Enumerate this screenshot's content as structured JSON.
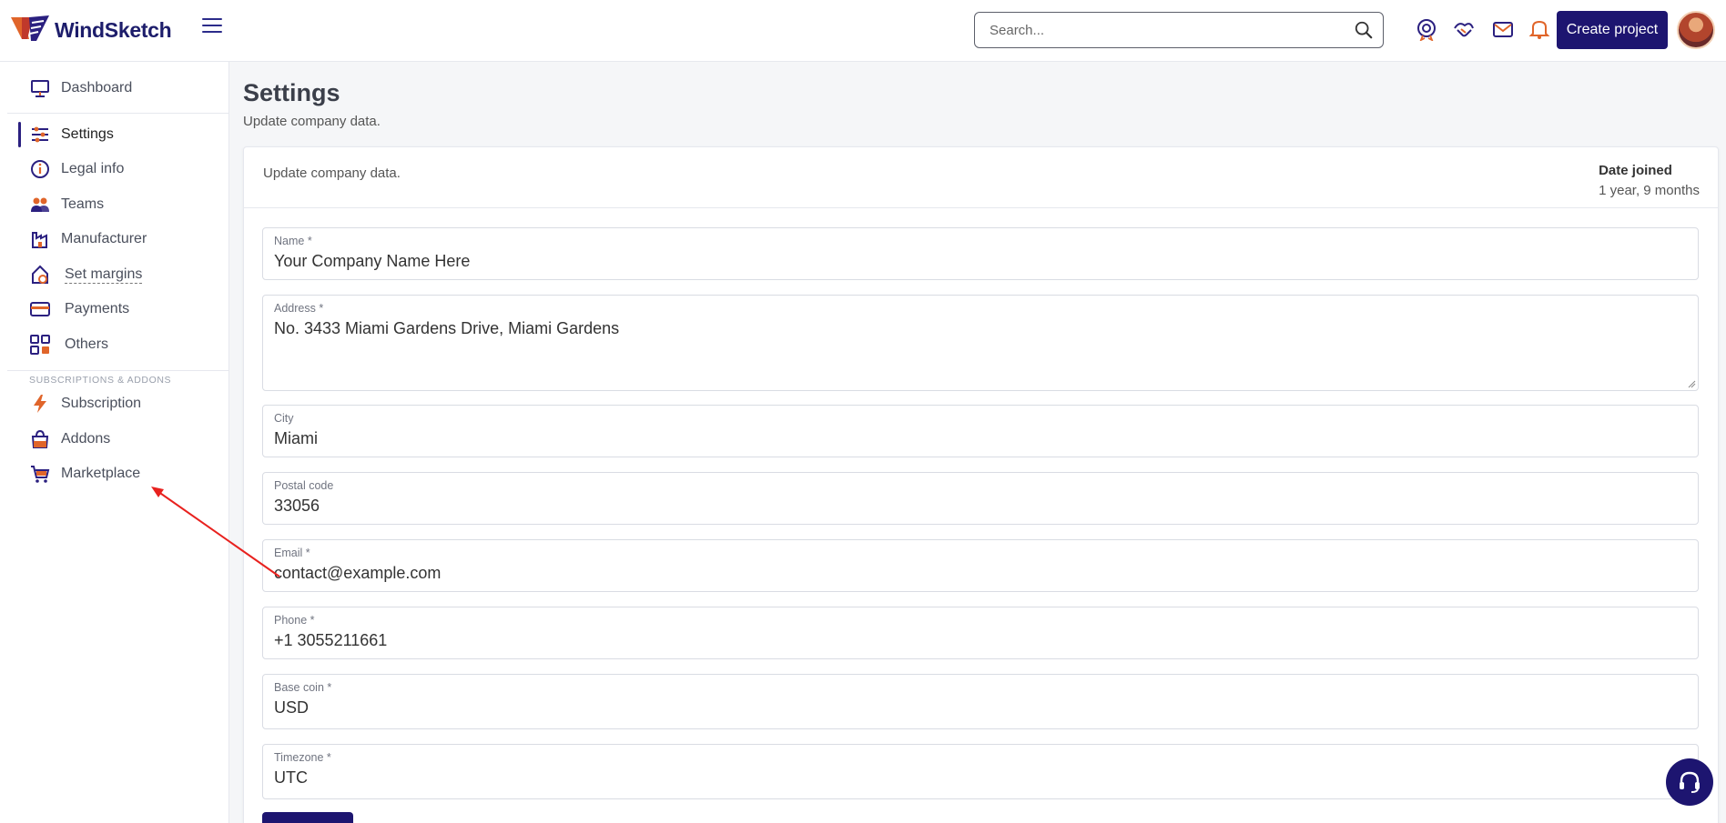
{
  "brand": {
    "name": "WindSketch"
  },
  "search": {
    "placeholder": "Search..."
  },
  "header": {
    "create_label": "Create project"
  },
  "sidebar": {
    "items": [
      {
        "label": "Dashboard",
        "icon": "monitor-icon"
      },
      {
        "label": "Settings",
        "icon": "sliders-icon",
        "active": true
      },
      {
        "label": "Legal info",
        "icon": "info-icon"
      },
      {
        "label": "Teams",
        "icon": "team-icon"
      },
      {
        "label": "Manufacturer",
        "icon": "factory-icon"
      },
      {
        "label": "Set margins",
        "icon": "margin-tag-icon"
      },
      {
        "label": "Payments",
        "icon": "card-icon"
      },
      {
        "label": "Others",
        "icon": "grid-icon"
      }
    ],
    "section_title": "SUBSCRIPTIONS & ADDONS",
    "addon_items": [
      {
        "label": "Subscription",
        "icon": "bolt-icon"
      },
      {
        "label": "Addons",
        "icon": "addon-bag-icon"
      },
      {
        "label": "Marketplace",
        "icon": "cart-icon"
      }
    ]
  },
  "page": {
    "title": "Settings",
    "subtitle": "Update company data."
  },
  "card": {
    "description": "Update company data.",
    "date_joined_label": "Date joined",
    "date_joined_value": "1 year, 9 months"
  },
  "form": {
    "name": {
      "label": "Name *",
      "value": "Your Company Name Here"
    },
    "address": {
      "label": "Address *",
      "value": "No. 3433 Miami Gardens Drive, Miami Gardens"
    },
    "city": {
      "label": "City",
      "value": "Miami"
    },
    "postal": {
      "label": "Postal code",
      "value": "33056"
    },
    "email": {
      "label": "Email *",
      "value": "contact@example.com"
    },
    "phone": {
      "label": "Phone *",
      "value": "+1 3055211661"
    },
    "base_coin": {
      "label": "Base coin *",
      "value": "USD"
    },
    "timezone": {
      "label": "Timezone *",
      "value": "UTC"
    }
  },
  "colors": {
    "primary": "#1d1570",
    "accent": "#e07a3a",
    "annotation": "#e8211e"
  }
}
